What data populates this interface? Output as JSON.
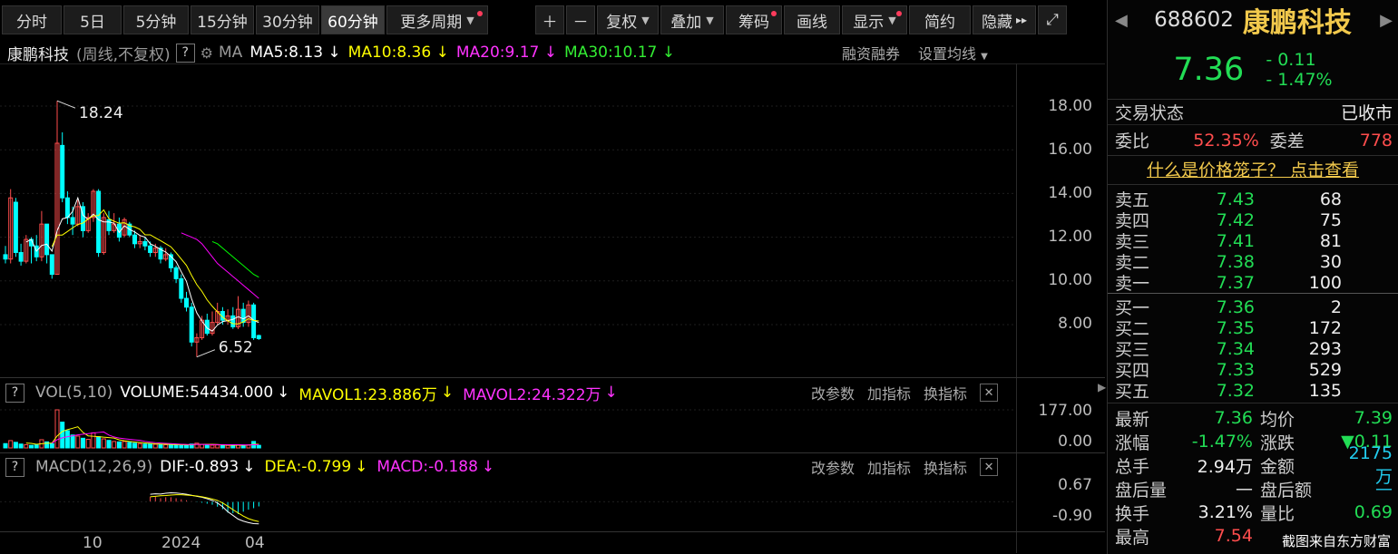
{
  "toolbar": {
    "periods": [
      "分时",
      "5日",
      "5分钟",
      "15分钟",
      "30分钟",
      "60分钟",
      "更多周期"
    ],
    "active_period": "60分钟",
    "plus": "＋",
    "minus": "－",
    "fuquan": "复权",
    "diejia": "叠加",
    "chouma": "筹码",
    "huaxian": "画线",
    "xianshi": "显示",
    "jianyue": "简约",
    "yincang": "隐藏",
    "yincang_icon": "▸▸",
    "fullscreen_icon": "⤢"
  },
  "chart_info": {
    "name": "康鹏科技",
    "subtitle": "(周线,不复权)",
    "q": "?",
    "ma": "MA",
    "ma5": "MA5:8.13",
    "ma10": "MA10:8.36",
    "ma20": "MA20:9.17",
    "ma30": "MA30:10.17",
    "arrow": "↓",
    "margin_trading": "融资融券",
    "set_ma": "设置均线"
  },
  "colors": {
    "ma5": "#ffffff",
    "ma10": "#ffff00",
    "ma20": "#ff00ff",
    "ma30": "#00ff00",
    "up": "#ff4d4d",
    "down": "#00ffff"
  },
  "annotations": {
    "high": "18.24",
    "low": "6.52"
  },
  "price_axis": [
    "18.00",
    "16.00",
    "14.00",
    "12.00",
    "10.00",
    "8.00"
  ],
  "vol_panel": {
    "q": "?",
    "label": "VOL(5,10)",
    "volume": "VOLUME:54434.000",
    "mavol1": "MAVOL1:23.886万",
    "mavol2": "MAVOL2:24.322万",
    "arrow": "↓",
    "axis": [
      "177.00",
      "0.00"
    ]
  },
  "macd_panel": {
    "q": "?",
    "label": "MACD(12,26,9)",
    "dif": "DIF:-0.893",
    "dea": "DEA:-0.799",
    "macd": "MACD:-0.188",
    "arrow": "↓",
    "axis": [
      "0.67",
      "-0.90"
    ]
  },
  "panel_links": {
    "gaicanshu": "改参数",
    "jiazhibiao": "加指标",
    "huanzhibiao": "换指标",
    "close": "✕"
  },
  "x_axis": [
    "10",
    "2024",
    "04"
  ],
  "chart_data": {
    "type": "candlestick",
    "period": "周线",
    "weeks": [
      {
        "o": 11.2,
        "c": 11.0,
        "h": 11.6,
        "l": 10.8
      },
      {
        "o": 11.0,
        "c": 13.8,
        "h": 14.2,
        "l": 10.8
      },
      {
        "o": 13.6,
        "c": 11.3,
        "h": 13.8,
        "l": 11.1
      },
      {
        "o": 11.3,
        "c": 10.9,
        "h": 11.7,
        "l": 10.7
      },
      {
        "o": 10.9,
        "c": 11.9,
        "h": 12.1,
        "l": 10.8
      },
      {
        "o": 11.9,
        "c": 11.6,
        "h": 12.0,
        "l": 10.8
      },
      {
        "o": 11.6,
        "c": 11.1,
        "h": 12.1,
        "l": 10.9
      },
      {
        "o": 11.1,
        "c": 12.6,
        "h": 13.2,
        "l": 10.9
      },
      {
        "o": 12.6,
        "c": 11.2,
        "h": 12.6,
        "l": 10.8
      },
      {
        "o": 11.2,
        "c": 10.3,
        "h": 11.2,
        "l": 10.1
      },
      {
        "o": 10.3,
        "c": 16.3,
        "h": 18.24,
        "l": 10.3
      },
      {
        "o": 16.2,
        "c": 13.8,
        "h": 16.8,
        "l": 13.6
      },
      {
        "o": 13.8,
        "c": 12.9,
        "h": 14.1,
        "l": 12.6
      },
      {
        "o": 12.9,
        "c": 12.6,
        "h": 13.4,
        "l": 12.1
      },
      {
        "o": 12.6,
        "c": 13.4,
        "h": 13.7,
        "l": 12.5
      },
      {
        "o": 13.4,
        "c": 12.3,
        "h": 13.6,
        "l": 12.0
      },
      {
        "o": 12.3,
        "c": 12.9,
        "h": 13.1,
        "l": 12.2
      },
      {
        "o": 12.9,
        "c": 14.1,
        "h": 14.2,
        "l": 12.7
      },
      {
        "o": 14.1,
        "c": 11.3,
        "h": 14.2,
        "l": 11.1
      },
      {
        "o": 11.3,
        "c": 12.9,
        "h": 13.1,
        "l": 11.2
      },
      {
        "o": 12.8,
        "c": 12.3,
        "h": 13.2,
        "l": 12.1
      },
      {
        "o": 12.3,
        "c": 12.6,
        "h": 13.1,
        "l": 12.2
      },
      {
        "o": 12.6,
        "c": 12.0,
        "h": 12.9,
        "l": 11.8
      },
      {
        "o": 12.1,
        "c": 12.8,
        "h": 12.9,
        "l": 12.0
      },
      {
        "o": 12.6,
        "c": 12.1,
        "h": 12.7,
        "l": 12.0
      },
      {
        "o": 12.1,
        "c": 11.7,
        "h": 12.3,
        "l": 11.5
      },
      {
        "o": 11.7,
        "c": 11.8,
        "h": 12.1,
        "l": 11.5
      },
      {
        "o": 11.8,
        "c": 11.6,
        "h": 12.0,
        "l": 11.4
      },
      {
        "o": 11.6,
        "c": 11.3,
        "h": 11.8,
        "l": 11.1
      },
      {
        "o": 11.3,
        "c": 11.5,
        "h": 11.7,
        "l": 11.1
      },
      {
        "o": 11.5,
        "c": 11.0,
        "h": 11.6,
        "l": 10.8
      },
      {
        "o": 11.0,
        "c": 11.2,
        "h": 11.5,
        "l": 10.9
      },
      {
        "o": 11.2,
        "c": 10.6,
        "h": 11.3,
        "l": 10.4
      },
      {
        "o": 10.6,
        "c": 10.1,
        "h": 10.7,
        "l": 9.9
      },
      {
        "o": 10.1,
        "c": 9.2,
        "h": 10.3,
        "l": 9.0
      },
      {
        "o": 9.2,
        "c": 8.8,
        "h": 9.5,
        "l": 8.6
      },
      {
        "o": 8.8,
        "c": 7.2,
        "h": 9.0,
        "l": 7.0
      },
      {
        "o": 7.2,
        "c": 7.4,
        "h": 7.6,
        "l": 6.52
      },
      {
        "o": 7.4,
        "c": 8.2,
        "h": 8.4,
        "l": 7.3
      },
      {
        "o": 8.2,
        "c": 7.6,
        "h": 8.5,
        "l": 7.5
      },
      {
        "o": 7.6,
        "c": 8.1,
        "h": 8.6,
        "l": 7.5
      },
      {
        "o": 8.1,
        "c": 8.6,
        "h": 9.0,
        "l": 8.0
      },
      {
        "o": 8.6,
        "c": 8.2,
        "h": 8.8,
        "l": 8.0
      },
      {
        "o": 8.2,
        "c": 8.4,
        "h": 8.7,
        "l": 8.0
      },
      {
        "o": 8.4,
        "c": 7.9,
        "h": 8.8,
        "l": 7.8
      },
      {
        "o": 7.9,
        "c": 8.7,
        "h": 9.3,
        "l": 7.8
      },
      {
        "o": 8.7,
        "c": 8.1,
        "h": 9.0,
        "l": 7.9
      },
      {
        "o": 8.1,
        "c": 8.9,
        "h": 9.1,
        "l": 7.9
      },
      {
        "o": 8.9,
        "c": 7.4,
        "h": 9.0,
        "l": 7.3
      },
      {
        "o": 7.5,
        "c": 7.36,
        "h": 7.54,
        "l": 7.3
      }
    ],
    "volumes": [
      20,
      34,
      26,
      18,
      15,
      12,
      14,
      38,
      28,
      20,
      177,
      120,
      80,
      60,
      55,
      45,
      40,
      70,
      52,
      42,
      35,
      30,
      28,
      30,
      26,
      22,
      20,
      18,
      19,
      17,
      16,
      15,
      15,
      14,
      14,
      14,
      18,
      22,
      16,
      14,
      13,
      14,
      12,
      12,
      13,
      15,
      12,
      14,
      30,
      12
    ],
    "ma20": [
      12.2,
      12.1,
      12.0,
      11.9,
      11.7,
      11.4,
      11.1,
      10.8,
      10.6,
      10.4,
      10.2,
      10.0,
      9.8,
      9.6,
      9.4,
      9.2
    ],
    "ma30": [
      11.8,
      11.7,
      11.5,
      11.3,
      11.1,
      10.9,
      10.7,
      10.5,
      10.3,
      10.17
    ],
    "macd_dif": [
      0.3,
      0.32,
      0.31,
      0.34,
      0.36,
      0.35,
      0.33,
      0.3,
      0.26,
      0.22,
      0.18,
      0.12,
      0.05,
      -0.05,
      -0.2,
      -0.4,
      -0.55,
      -0.7,
      -0.78,
      -0.84,
      -0.88,
      -0.893
    ],
    "macd_dea": [
      0.2,
      0.22,
      0.24,
      0.25,
      0.27,
      0.28,
      0.28,
      0.27,
      0.25,
      0.23,
      0.2,
      0.16,
      0.11,
      0.05,
      -0.05,
      -0.18,
      -0.32,
      -0.45,
      -0.58,
      -0.68,
      -0.75,
      -0.799
    ]
  },
  "quote": {
    "code": "688602",
    "name": "康鹏科技",
    "price": "7.36",
    "change": "- 0.11",
    "change_pct": "- 1.47%",
    "status_label": "交易状态",
    "status_value": "已收市",
    "weibi_label": "委比",
    "weibi_value": "52.35%",
    "weicha_label": "委差",
    "weicha_value": "778",
    "cage_link": "什么是价格笼子？ 点击查看",
    "asks": [
      {
        "label": "卖五",
        "price": "7.43",
        "vol": "68"
      },
      {
        "label": "卖四",
        "price": "7.42",
        "vol": "75"
      },
      {
        "label": "卖三",
        "price": "7.41",
        "vol": "81"
      },
      {
        "label": "卖二",
        "price": "7.38",
        "vol": "30"
      },
      {
        "label": "卖一",
        "price": "7.37",
        "vol": "100"
      }
    ],
    "bids": [
      {
        "label": "买一",
        "price": "7.36",
        "vol": "2"
      },
      {
        "label": "买二",
        "price": "7.35",
        "vol": "172"
      },
      {
        "label": "买三",
        "price": "7.34",
        "vol": "293"
      },
      {
        "label": "买四",
        "price": "7.33",
        "vol": "529"
      },
      {
        "label": "买五",
        "price": "7.32",
        "vol": "135"
      }
    ],
    "stats": [
      [
        "最新",
        "7.36",
        "均价",
        "7.39"
      ],
      [
        "涨幅",
        "-1.47%",
        "涨跌",
        "▼0.11"
      ],
      [
        "总手",
        "2.94万",
        "金额",
        "2175万"
      ],
      [
        "盘后量",
        "—",
        "盘后额",
        "—"
      ],
      [
        "换手",
        "3.21%",
        "量比",
        "0.69"
      ],
      [
        "最高",
        "7.54",
        "",
        ""
      ]
    ],
    "watermark": "截图来自东方财富",
    "nav_left": "◀",
    "nav_right": "▶",
    "collapse": "▶"
  }
}
